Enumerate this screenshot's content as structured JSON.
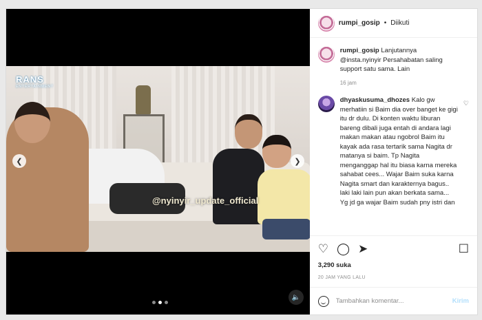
{
  "post": {
    "username": "rumpi_gosip",
    "separator": "•",
    "follow_status": "Diikuti"
  },
  "caption": {
    "username": "rumpi_gosip",
    "text": "Lanjutannya @insta.nyinyir Persahabatan saling support satu sama. Lain",
    "time": "16 jam"
  },
  "comment1": {
    "username": "dhyaskusuma_dhozes",
    "text": "Kalo gw merhatiin si Baim dia over banget ke gigi itu dr dulu. Di konten waktu liburan bareng dibali juga entah di andara lagi makan makan atau ngobrol Baim itu kayak ada rasa tertarik sama Nagita dr matanya si baim. Tp Nagita menganggap hal itu biasa karna mereka sahabat cees... Wajar Baim suka karna Nagita smart dan karakternya bagus.. laki laki lain pun akan berkata sama... Yg jd ga wajar Baim sudah pny istri dan"
  },
  "video": {
    "logo": "RANS",
    "logo_sub": "ENTERTAINMENT",
    "watermark": "@nyinyir_update_official"
  },
  "icons": {
    "like": "heart-icon",
    "comment": "comment-icon",
    "share": "share-icon",
    "save": "bookmark-icon",
    "emoji": "emoji-icon",
    "mute": "speaker-icon"
  },
  "stats": {
    "likes": "3,290 suka",
    "date": "20 JAM YANG LALU"
  },
  "comment_box": {
    "placeholder": "Tambahkan komentar...",
    "send_label": "Kirim"
  },
  "carousel": {
    "current_slide": 2,
    "total_slides": 3
  }
}
